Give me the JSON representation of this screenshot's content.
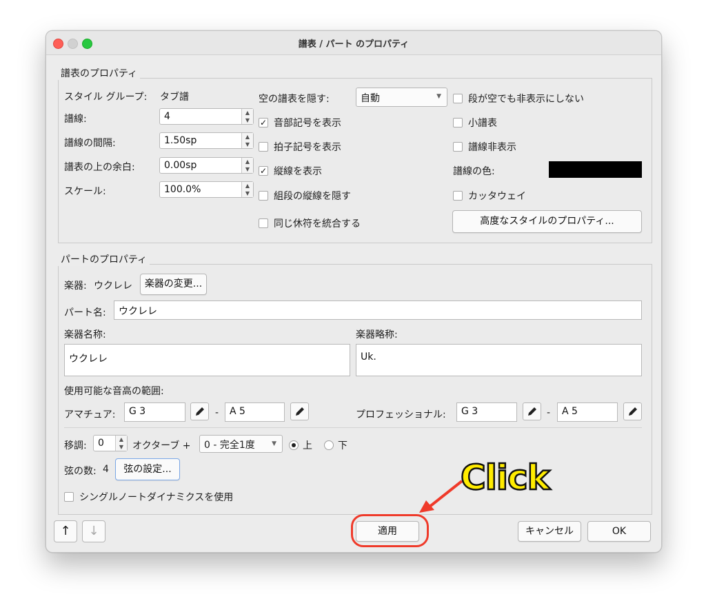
{
  "window": {
    "title": "譜表 / パート のプロパティ"
  },
  "staff_props": {
    "group_label": "譜表のプロパティ",
    "style_group_label": "スタイル グループ:",
    "style_group_value": "タブ譜",
    "lines_label": "譜線:",
    "lines_value": "4",
    "spacing_label": "譜線の間隔:",
    "spacing_value": "1.50sp",
    "top_margin_label": "譜表の上の余白:",
    "top_margin_value": "0.00sp",
    "scale_label": "スケール:",
    "scale_value": "100.0%",
    "hide_empty_label": "空の譜表を隠す:",
    "hide_empty_value": "自動",
    "show_clef": {
      "label": "音部記号を表示",
      "checked": true
    },
    "show_timesig": {
      "label": "拍子記号を表示",
      "checked": false
    },
    "show_barlines": {
      "label": "縦線を表示",
      "checked": true
    },
    "hide_system_barlines": {
      "label": "組段の縦線を隠す",
      "checked": false
    },
    "merge_rests": {
      "label": "同じ休符を統合する",
      "checked": false
    },
    "dont_hide_empty": {
      "label": "段が空でも非表示にしない",
      "checked": false
    },
    "small_staff": {
      "label": "小譜表",
      "checked": false
    },
    "hide_lines": {
      "label": "譜線非表示",
      "checked": false
    },
    "line_color_label": "譜線の色:",
    "line_color": "#000000",
    "cutaway": {
      "label": "カッタウェイ",
      "checked": false
    },
    "advanced_button": "高度なスタイルのプロパティ..."
  },
  "part_props": {
    "group_label": "パートのプロパティ",
    "instrument_label": "楽器:",
    "instrument_value": "ウクレレ",
    "change_instrument_button": "楽器の変更...",
    "part_name_label": "パート名:",
    "part_name_value": "ウクレレ",
    "long_name_label": "楽器名称:",
    "long_name_value": "ウクレレ",
    "short_name_label": "楽器略称:",
    "short_name_value": "Uk.",
    "range_label": "使用可能な音高の範囲:",
    "amateur_label": "アマチュア:",
    "amateur_low": "G 3",
    "amateur_high": "A 5",
    "pro_label": "プロフェッショナル:",
    "pro_low": "G 3",
    "pro_high": "A 5",
    "dash": "-",
    "transpose_label": "移調:",
    "transpose_octave": "0",
    "octave_plus_label": "オクターブ +",
    "interval_value": "0 - 完全1度",
    "up_label": "上",
    "down_label": "下",
    "strings_label": "弦の数:",
    "strings_value": "4",
    "string_settings_button": "弦の設定...",
    "single_note_dynamics": {
      "label": "シングルノートダイナミクスを使用",
      "checked": false
    }
  },
  "footer": {
    "up_arrow": "↑",
    "down_arrow": "↓",
    "apply_button": "適用",
    "cancel_button": "キャンセル",
    "ok_button": "OK"
  },
  "annotation": {
    "text": "Click",
    "color": "#ffec00",
    "highlight_color": "#ef3a2a"
  }
}
